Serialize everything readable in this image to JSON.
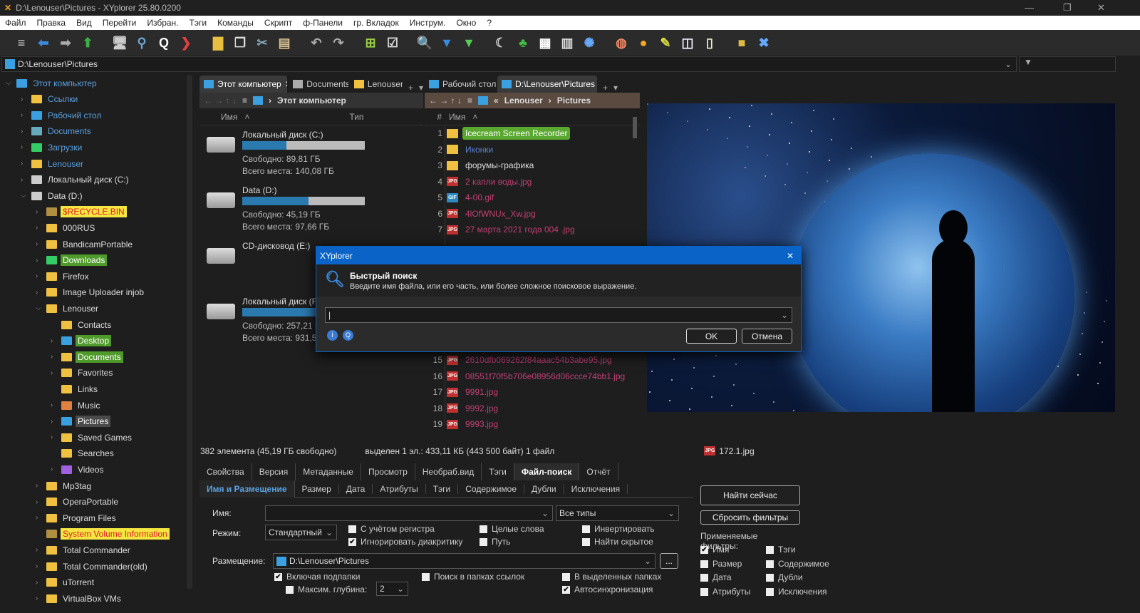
{
  "window": {
    "title": "D:\\Lenouser\\Pictures - XYplorer 25.80.0200",
    "min": "—",
    "max": "❐",
    "close": "✕"
  },
  "menu": [
    "Файл",
    "Правка",
    "Вид",
    "Перейти",
    "Избран.",
    "Тэги",
    "Команды",
    "Скрипт",
    "ф-Панели",
    "гр. Вкладок",
    "Инструм.",
    "Окно",
    "?"
  ],
  "toolbar": [
    {
      "icon": "menu-icon",
      "g": "≡",
      "c": "#ccc"
    },
    {
      "icon": "back-icon",
      "g": "⬅",
      "c": "#3a8be0"
    },
    {
      "icon": "forward-icon",
      "g": "➡",
      "c": "#aaa"
    },
    {
      "icon": "up-icon",
      "g": "⬆",
      "c": "#3cb043"
    },
    {
      "icon": "computer-icon",
      "g": "🖥",
      "c": "#ccc"
    },
    {
      "icon": "location-icon",
      "g": "⚲",
      "c": "#6aa8d8"
    },
    {
      "icon": "find-icon",
      "g": "Q",
      "c": "#fff"
    },
    {
      "icon": "goto-icon",
      "g": "❯",
      "c": "#e04040"
    },
    {
      "icon": "new-folder-icon",
      "g": "▇",
      "c": "#e8c040"
    },
    {
      "icon": "copy-icon",
      "g": "❐",
      "c": "#ddd"
    },
    {
      "icon": "cut-icon",
      "g": "✂",
      "c": "#8ab"
    },
    {
      "icon": "paste-icon",
      "g": "▤",
      "c": "#d8c090"
    },
    {
      "icon": "undo-icon",
      "g": "↶",
      "c": "#aaa"
    },
    {
      "icon": "redo-icon",
      "g": "↷",
      "c": "#aaa"
    },
    {
      "icon": "tree-icon",
      "g": "⊞",
      "c": "#9c4"
    },
    {
      "icon": "checkbox-icon",
      "g": "☑",
      "c": "#ddd"
    },
    {
      "icon": "search-icon",
      "g": "🔍",
      "c": "#3a8be0"
    },
    {
      "icon": "filter-icon",
      "g": "▼",
      "c": "#3a8be0"
    },
    {
      "icon": "green-filter-icon",
      "g": "▼",
      "c": "#5c5"
    },
    {
      "icon": "dark-mode-icon",
      "g": "☾",
      "c": "#ccc"
    },
    {
      "icon": "tree-green-icon",
      "g": "♣",
      "c": "#4b4"
    },
    {
      "icon": "grid-icon",
      "g": "▦",
      "c": "#fff"
    },
    {
      "icon": "calculator-icon",
      "g": "▥",
      "c": "#ddd"
    },
    {
      "icon": "gear-blue-icon",
      "g": "✺",
      "c": "#6af"
    },
    {
      "icon": "basketball-icon",
      "g": "◍",
      "c": "#e86"
    },
    {
      "icon": "colors-icon",
      "g": "●",
      "c": "#f5a623"
    },
    {
      "icon": "brush-icon",
      "g": "✎",
      "c": "#dd4"
    },
    {
      "icon": "dual-pane-icon",
      "g": "◫",
      "c": "#eef"
    },
    {
      "icon": "notepad-icon",
      "g": "▯",
      "c": "#eec"
    },
    {
      "icon": "stop-icon",
      "g": "■",
      "c": "#db4"
    },
    {
      "icon": "tools-icon",
      "g": "✖",
      "c": "#6af"
    }
  ],
  "address": "D:\\Lenouser\\Pictures",
  "tree": [
    {
      "l": 0,
      "t": "Этот компьютер",
      "exp": "v",
      "ic": "#3aa0e0",
      "c": "#5aa0e0"
    },
    {
      "l": 1,
      "t": "Ссылки",
      "exp": ">",
      "ic": "#f0c040",
      "c": "#5aa0e0"
    },
    {
      "l": 1,
      "t": "Рабочий стол",
      "exp": ">",
      "ic": "#3aa0e0",
      "c": "#5aa0e0"
    },
    {
      "l": 1,
      "t": "Documents",
      "exp": ">",
      "ic": "#6ab",
      "c": "#5aa0e0"
    },
    {
      "l": 1,
      "t": "Загрузки",
      "exp": ">",
      "ic": "#3c6",
      "c": "#5aa0e0"
    },
    {
      "l": 1,
      "t": "Lenouser",
      "exp": ">",
      "ic": "#f0c040",
      "c": "#5aa0e0"
    },
    {
      "l": 1,
      "t": "Локальный диск (C:)",
      "exp": ">",
      "ic": "#ccc",
      "c": "#ddd"
    },
    {
      "l": 1,
      "t": "Data (D:)",
      "exp": "v",
      "ic": "#ccc",
      "c": "#ddd"
    },
    {
      "l": 2,
      "t": "$RECYCLE.BIN",
      "exp": ">",
      "ic": "#b09040",
      "c": "#d22",
      "bg": "#f5e642"
    },
    {
      "l": 2,
      "t": "000RUS",
      "exp": ">",
      "ic": "#f0c040",
      "c": "#ddd"
    },
    {
      "l": 2,
      "t": "BandicamPortable",
      "exp": ">",
      "ic": "#f0c040",
      "c": "#ddd"
    },
    {
      "l": 2,
      "t": "Downloads",
      "exp": ">",
      "ic": "#3c6",
      "c": "#fff",
      "bg": "#4e9a2a"
    },
    {
      "l": 2,
      "t": "Firefox",
      "exp": ">",
      "ic": "#f0c040",
      "c": "#ddd"
    },
    {
      "l": 2,
      "t": "Image Uploader injob",
      "exp": ">",
      "ic": "#f0c040",
      "c": "#ddd"
    },
    {
      "l": 2,
      "t": "Lenouser",
      "exp": "v",
      "ic": "#f0c040",
      "c": "#ddd"
    },
    {
      "l": 3,
      "t": "Contacts",
      "exp": "",
      "ic": "#f0c040",
      "c": "#ddd"
    },
    {
      "l": 3,
      "t": "Desktop",
      "exp": ">",
      "ic": "#3aa0e0",
      "c": "#fff",
      "bg": "#4e9a2a"
    },
    {
      "l": 3,
      "t": "Documents",
      "exp": ">",
      "ic": "#f0c040",
      "c": "#fff",
      "bg": "#4e9a2a"
    },
    {
      "l": 3,
      "t": "Favorites",
      "exp": ">",
      "ic": "#f0c040",
      "c": "#ddd"
    },
    {
      "l": 3,
      "t": "Links",
      "exp": "",
      "ic": "#f0c040",
      "c": "#ddd"
    },
    {
      "l": 3,
      "t": "Music",
      "exp": ">",
      "ic": "#e08040",
      "c": "#ddd"
    },
    {
      "l": 3,
      "t": "Pictures",
      "exp": ">",
      "ic": "#3aa0e0",
      "c": "#fff",
      "bg": "#4a4a4a"
    },
    {
      "l": 3,
      "t": "Saved Games",
      "exp": ">",
      "ic": "#f0c040",
      "c": "#ddd"
    },
    {
      "l": 3,
      "t": "Searches",
      "exp": "",
      "ic": "#f0c040",
      "c": "#ddd"
    },
    {
      "l": 3,
      "t": "Videos",
      "exp": ">",
      "ic": "#a060e0",
      "c": "#ddd"
    },
    {
      "l": 2,
      "t": "Mp3tag",
      "exp": ">",
      "ic": "#f0c040",
      "c": "#ddd"
    },
    {
      "l": 2,
      "t": "OperaPortable",
      "exp": ">",
      "ic": "#f0c040",
      "c": "#ddd"
    },
    {
      "l": 2,
      "t": "Program Files",
      "exp": ">",
      "ic": "#f0c040",
      "c": "#ddd"
    },
    {
      "l": 2,
      "t": "System Volume Information",
      "exp": "",
      "ic": "#b09040",
      "c": "#d22",
      "bg": "#f5e642"
    },
    {
      "l": 2,
      "t": "Total Commander",
      "exp": ">",
      "ic": "#f0c040",
      "c": "#ddd"
    },
    {
      "l": 2,
      "t": "Total Commander(old)",
      "exp": ">",
      "ic": "#f0c040",
      "c": "#ddd"
    },
    {
      "l": 2,
      "t": "uTorrent",
      "exp": ">",
      "ic": "#f0c040",
      "c": "#ddd"
    },
    {
      "l": 2,
      "t": "VirtualBox VMs",
      "exp": ">",
      "ic": "#f0c040",
      "c": "#ddd"
    }
  ],
  "left_pane": {
    "tabs": [
      "Этот компьютер",
      "Documents",
      "Lenouser"
    ],
    "crumb": "Этот компьютер",
    "col_name": "Имя",
    "col_type": "Тип",
    "drives": [
      {
        "name": "Локальный диск (C:)",
        "free": "Свободно: 89,81 ГБ",
        "total": "Всего места: 140,08 ГБ",
        "used": 0.36
      },
      {
        "name": "Data (D:)",
        "free": "Свободно: 45,19 ГБ",
        "total": "Всего места: 97,66 ГБ",
        "used": 0.54
      },
      {
        "name": "CD-дисковод (E:)",
        "free": "",
        "total": "",
        "used": null
      },
      {
        "name": "Локальный диск (F:)",
        "free": "Свободно: 257,21 ГБ",
        "total": "Всего места: 931,51 ГБ",
        "used": 0.72
      }
    ]
  },
  "right_pane": {
    "tabs": [
      "Рабочий стол",
      "D:\\Lenouser\\Pictures"
    ],
    "crumb": [
      "«",
      "Lenouser",
      "›",
      "Pictures"
    ],
    "col_num": "#",
    "col_name": "Имя",
    "files": [
      {
        "n": "1",
        "t": "Icecream Screen Recorder",
        "k": "folder",
        "c": "#fff",
        "bg": "#5aa830"
      },
      {
        "n": "2",
        "t": "Иконки",
        "k": "folder",
        "c": "#5a80d0"
      },
      {
        "n": "3",
        "t": "форумы-графика",
        "k": "folder",
        "c": "#ddd"
      },
      {
        "n": "4",
        "t": "2 капли воды.jpg",
        "k": "JPG",
        "c": "#c04070"
      },
      {
        "n": "5",
        "t": "4-00.gif",
        "k": "GIF",
        "c": "#c04070"
      },
      {
        "n": "6",
        "t": "4lOfWNUx_Xw.jpg",
        "k": "JPG",
        "c": "#c04070"
      },
      {
        "n": "7",
        "t": "27 марта 2021 года 004 .jpg",
        "k": "JPG",
        "c": "#c04070"
      },
      {
        "n": "15",
        "t": "2610dfb069262f84aaac54b3abe95.jpg",
        "k": "JPG",
        "c": "#c04070"
      },
      {
        "n": "16",
        "t": "08551f70f5b706e08956d06ccce74bb1.jpg",
        "k": "JPG",
        "c": "#c04070"
      },
      {
        "n": "17",
        "t": "9991.jpg",
        "k": "JPG",
        "c": "#c04070"
      },
      {
        "n": "18",
        "t": "9992.jpg",
        "k": "JPG",
        "c": "#c04070"
      },
      {
        "n": "19",
        "t": "9993.jpg",
        "k": "JPG",
        "c": "#c04070"
      }
    ]
  },
  "status": {
    "count": "382 элемента (45,19 ГБ свободно)",
    "selected": "выделен 1 эл.: 433,11 КБ (443 500 байт)  1 файл",
    "preview_file": "172.1.jpg"
  },
  "info_tabs": [
    "Свойства",
    "Версия",
    "Метаданные",
    "Просмотр",
    "Необраб.вид",
    "Тэги",
    "Файл-поиск",
    "Отчёт"
  ],
  "search_tabs": [
    "Имя и Размещение",
    "Размер",
    "Дата",
    "Атрибуты",
    "Тэги",
    "Содержимое",
    "Дубли",
    "Исключения"
  ],
  "search": {
    "name_label": "Имя:",
    "name_value": "",
    "type_value": "Все типы",
    "mode_label": "Режим:",
    "mode_value": "Стандартный",
    "opts": [
      {
        "t": "С учётом регистра",
        "on": false
      },
      {
        "t": "Игнорировать диакритику",
        "on": true
      },
      {
        "t": "Целые слова",
        "on": false
      },
      {
        "t": "Путь",
        "on": false
      },
      {
        "t": "Инвертировать",
        "on": false
      },
      {
        "t": "Найти скрытое",
        "on": false
      }
    ],
    "loc_label": "Размещение:",
    "loc_value": "D:\\Lenouser\\Pictures",
    "browse": "...",
    "sub": [
      {
        "t": "Включая подпапки",
        "on": true
      },
      {
        "t": "Поиск в папках ссылок",
        "on": false
      },
      {
        "t": "В выделенных папках",
        "on": false
      },
      {
        "t": "Максим. глубина:",
        "on": false
      },
      {
        "t": "Автосинхронизация",
        "on": true
      }
    ],
    "depth": "2",
    "find_now": "Найти сейчас",
    "reset": "Сбросить фильтры",
    "applied": "Применяемые фильтры:",
    "filters": [
      {
        "t": "Имя",
        "on": true
      },
      {
        "t": "Тэги",
        "on": false
      },
      {
        "t": "Размер",
        "on": false
      },
      {
        "t": "Содержимое",
        "on": false
      },
      {
        "t": "Дата",
        "on": false
      },
      {
        "t": "Дубли",
        "on": false
      },
      {
        "t": "Атрибуты",
        "on": false
      },
      {
        "t": "Исключения",
        "on": false
      }
    ]
  },
  "dialog": {
    "title": "XYplorer",
    "heading": "Быстрый поиск",
    "desc": "Введите имя файла, или его часть, или более сложное поисковое выражение.",
    "value": "",
    "ok": "OK",
    "cancel": "Отмена"
  }
}
